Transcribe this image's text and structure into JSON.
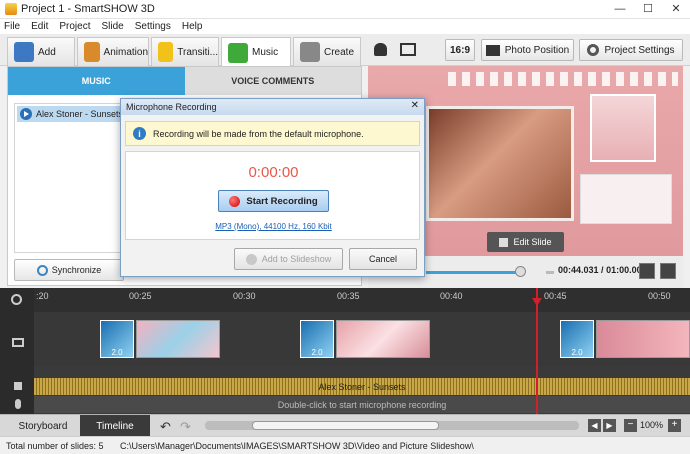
{
  "window": {
    "title": "Project 1 - SmartSHOW 3D",
    "minimize": "—",
    "maximize": "☐",
    "close": "✕"
  },
  "menu": [
    "File",
    "Edit",
    "Project",
    "Slide",
    "Settings",
    "Help"
  ],
  "toolbar": {
    "tabs": [
      {
        "label": "Add",
        "icon": "add-photo-icon",
        "color": "#3d79c2"
      },
      {
        "label": "Animation",
        "icon": "palette-icon",
        "color": "#d98a2a"
      },
      {
        "label": "Transiti...",
        "icon": "star-icon",
        "color": "#f2c21a"
      },
      {
        "label": "Music",
        "icon": "music-note-icon",
        "color": "#3faa3a"
      },
      {
        "label": "Create",
        "icon": "film-reel-icon",
        "color": "#888888"
      }
    ],
    "active_tab": "Music",
    "aspect": "16:9",
    "photo_position": "Photo Position",
    "project_settings": "Project Settings"
  },
  "music_panel": {
    "tab_music": "MUSIC",
    "tab_voice": "VOICE COMMENTS",
    "track": "Alex Stoner - Sunsets",
    "synchronize": "Synchronize"
  },
  "preview": {
    "edit_slide": "Edit Slide",
    "time_current": "00:44.031",
    "time_total": "01:00.000",
    "time_separator": " / ",
    "progress_fraction": 0.734
  },
  "dialog": {
    "title": "Microphone Recording",
    "info": "Recording will be made from the default microphone.",
    "timer": "0:00:00",
    "start": "Start Recording",
    "format": "MP3 (Mono), 44100 Hz, 160 Kbit",
    "add": "Add to Slideshow",
    "cancel": "Cancel"
  },
  "timeline": {
    "ticks": [
      ":20",
      "00:25",
      "00:30",
      "00:35",
      "00:40",
      "00:45",
      "00:50"
    ],
    "transition_duration": "2.0",
    "audio_label": "Alex Stoner - Sunsets",
    "mic_hint": "Double-click to start microphone recording"
  },
  "bottom": {
    "storyboard": "Storyboard",
    "timeline": "Timeline",
    "zoom": "100%"
  },
  "status": {
    "slides": "Total number of slides: 5",
    "path": "C:\\Users\\Manager\\Documents\\IMAGES\\SMARTSHOW 3D\\Video and Picture Slideshow\\"
  }
}
